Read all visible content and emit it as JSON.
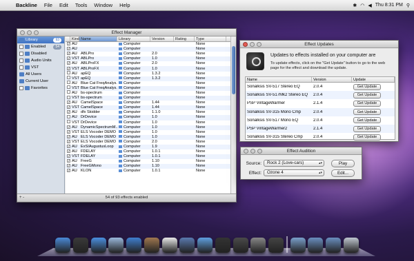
{
  "menubar": {
    "app_name": "Backline",
    "menus": [
      "File",
      "Edit",
      "Tools",
      "Window",
      "Help"
    ],
    "clock": "Thu 8:31 PM",
    "icons": [
      "bluetooth-icon",
      "wifi-icon",
      "volume-icon",
      "spotlight-icon"
    ]
  },
  "effect_manager": {
    "title": "Effect Manager",
    "sidebar": [
      {
        "label": "Library",
        "count": "93",
        "selected": true,
        "has_checkbox": false
      },
      {
        "label": "Enabled",
        "count": "54",
        "selected": false,
        "has_checkbox": true
      },
      {
        "label": "Disabled",
        "count": "",
        "selected": false,
        "has_checkbox": true
      },
      {
        "label": "Audio Units",
        "count": "",
        "selected": false,
        "has_checkbox": true
      },
      {
        "label": "VST",
        "count": "",
        "selected": false,
        "has_checkbox": true
      },
      {
        "label": "All Users",
        "count": "",
        "selected": false,
        "has_checkbox": false
      },
      {
        "label": "Current User",
        "count": "",
        "selected": false,
        "has_checkbox": false
      },
      {
        "label": "Favorites",
        "count": "",
        "selected": false,
        "has_checkbox": true
      }
    ],
    "columns": [
      "",
      "Kind",
      "Name",
      "Library",
      "Version",
      "Rating",
      "Type"
    ],
    "rows": [
      {
        "checked": true,
        "kind": "AU",
        "name": "",
        "library": "Computer",
        "version": "",
        "type": "None"
      },
      {
        "checked": true,
        "kind": "AU",
        "name": "",
        "library": "Computer",
        "version": "",
        "type": "None"
      },
      {
        "checked": true,
        "kind": "AU",
        "name": "ABLPro",
        "library": "Computer",
        "version": "2.0",
        "type": "None"
      },
      {
        "checked": true,
        "kind": "VST",
        "name": "ABLPro",
        "library": "Computer",
        "version": "1.0",
        "type": "None"
      },
      {
        "checked": true,
        "kind": "AU",
        "name": "ABLProFX",
        "library": "Computer",
        "version": "2.0",
        "type": "None"
      },
      {
        "checked": true,
        "kind": "VST",
        "name": "ABLProFX",
        "library": "Computer",
        "version": "1.0",
        "type": "None"
      },
      {
        "checked": false,
        "kind": "AU",
        "name": "apEQ",
        "library": "Computer",
        "version": "1.3.2",
        "type": "None"
      },
      {
        "checked": false,
        "kind": "VST",
        "name": "apEQ",
        "library": "Computer",
        "version": "1.3.2",
        "type": "None"
      },
      {
        "checked": false,
        "kind": "AU",
        "name": "Blue Cat FreqAnalys...",
        "library": "Computer",
        "version": "",
        "type": "None"
      },
      {
        "checked": false,
        "kind": "VST",
        "name": "Blue Cat FreqAnalys...",
        "library": "Computer",
        "version": "",
        "type": "None"
      },
      {
        "checked": false,
        "kind": "AU",
        "name": "bs-spectrum",
        "library": "Computer",
        "version": "",
        "type": "None"
      },
      {
        "checked": false,
        "kind": "VST",
        "name": "bs-spectrum",
        "library": "Computer",
        "version": "",
        "type": "None"
      },
      {
        "checked": true,
        "kind": "AU",
        "name": "CamelSpace",
        "library": "Computer",
        "version": "1.44",
        "type": "None"
      },
      {
        "checked": true,
        "kind": "VST",
        "name": "CamelSpace",
        "library": "Computer",
        "version": "1.44",
        "type": "None"
      },
      {
        "checked": true,
        "kind": "AU",
        "name": "dfx Skidder",
        "library": "Computer",
        "version": "1.1.0",
        "type": "None"
      },
      {
        "checked": false,
        "kind": "AU",
        "name": "DrDevice",
        "library": "Computer",
        "version": "1.0",
        "type": "None"
      },
      {
        "checked": false,
        "kind": "VST",
        "name": "DrDevice",
        "library": "Computer",
        "version": "1.0",
        "type": "None"
      },
      {
        "checked": true,
        "kind": "AU",
        "name": "DynamicSpectrumM...",
        "library": "Computer",
        "version": "1.0",
        "type": "None"
      },
      {
        "checked": true,
        "kind": "VST",
        "name": "ELS Vocoder DEMO",
        "library": "Computer",
        "version": "1.0",
        "type": "None"
      },
      {
        "checked": true,
        "kind": "AU",
        "name": "ELS Vocoder DEMO",
        "library": "Computer",
        "version": "1.0",
        "type": "None"
      },
      {
        "checked": true,
        "kind": "VST",
        "name": "ELS Vocoder DEMO",
        "library": "Computer",
        "version": "2.0",
        "type": "None"
      },
      {
        "checked": true,
        "kind": "AU",
        "name": "ExSIAugustusLoop",
        "library": "Computer",
        "version": "1.9",
        "type": "None"
      },
      {
        "checked": true,
        "kind": "AU",
        "name": "FDELAY",
        "library": "Computer",
        "version": "1.0.1",
        "type": "None"
      },
      {
        "checked": true,
        "kind": "VST",
        "name": "FDELAY",
        "library": "Computer",
        "version": "1.0.1",
        "type": "None"
      },
      {
        "checked": true,
        "kind": "AU",
        "name": "FreeG",
        "library": "Computer",
        "version": "1.10",
        "type": "None"
      },
      {
        "checked": true,
        "kind": "AU",
        "name": "FreeGMono",
        "library": "Computer",
        "version": "1.10",
        "type": "None"
      },
      {
        "checked": true,
        "kind": "AU",
        "name": "KLON",
        "library": "Computer",
        "version": "1.0.1",
        "type": "None"
      }
    ],
    "status": "54 of 93 effects enabled",
    "bottom_buttons": "+ -"
  },
  "effect_updates": {
    "title": "Effect Updates",
    "heading": "Updates to effects installed on your computer are",
    "description": "To update effects, click on the \"Get Update\" button to go to the web page for the effect and download the update.",
    "columns": [
      "Name",
      "Version",
      "Update"
    ],
    "rows": [
      {
        "name": "Sonalksis SV-517 Stereo EQ",
        "version": "2.0.4",
        "button": "Get Update"
      },
      {
        "name": "Sonalksis SV-517Mk2 Stereo EQ",
        "version": "2.0.4",
        "button": "Get Update"
      },
      {
        "name": "PSP VintageWarmer",
        "version": "2.1.4",
        "button": "Get Update"
      },
      {
        "name": "Sonalksis SV-315 Mono Cmp",
        "version": "2.0.4",
        "button": "Get Update"
      },
      {
        "name": "Sonalksis SV-517 Mono EQ",
        "version": "2.0.4",
        "button": "Get Update"
      },
      {
        "name": "PSP VintageWarmer2",
        "version": "2.1.4",
        "button": "Get Update"
      },
      {
        "name": "Sonalksis SV-315 Stereo Cmp",
        "version": "2.0.4",
        "button": "Get Update"
      }
    ]
  },
  "effect_audition": {
    "title": "Effect Audition",
    "source_label": "Source:",
    "source_value": "Rock 2 (Love-cars)",
    "play_label": "Play",
    "effect_label": "Effect:",
    "effect_value": "Ozone 4",
    "edit_label": "Edit..."
  },
  "dock": {
    "items": [
      "finder-icon",
      "dashboard-icon",
      "safari-icon",
      "mail-icon",
      "ichat-icon",
      "address-book-icon",
      "ical-icon",
      "iphoto-icon",
      "itunes-icon",
      "dvd-player-icon",
      "time-machine-icon",
      "system-preferences-icon",
      "backline-icon",
      "applications-folder-icon",
      "documents-folder-icon",
      "downloads-folder-icon",
      "trash-icon"
    ]
  }
}
